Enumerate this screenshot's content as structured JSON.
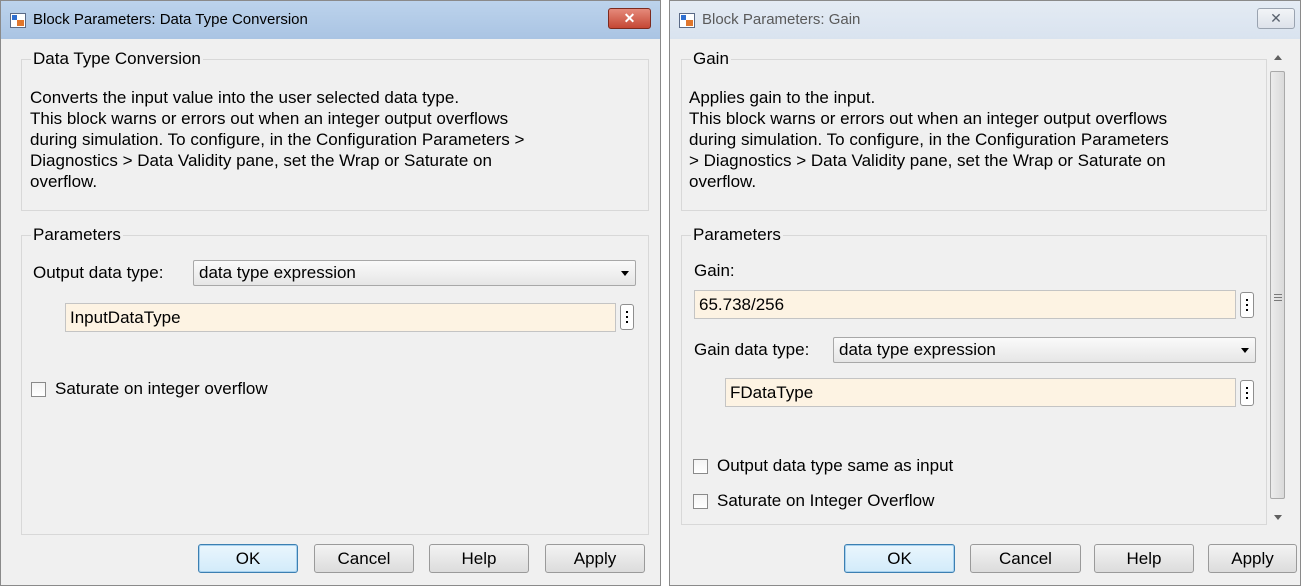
{
  "left_dialog": {
    "title": "Block Parameters: Data Type Conversion",
    "block_name": "Data Type Conversion",
    "description": [
      "Converts the input value into the user selected data type.",
      "This block warns or errors out when an integer output overflows",
      "during simulation. To configure, in the Configuration Parameters >",
      "Diagnostics > Data Validity pane, set the Wrap or Saturate on",
      "overflow."
    ],
    "parameters_label": "Parameters",
    "output_data_type_label": "Output data type:",
    "output_data_type_value": "data type expression",
    "expression_value": "InputDataType",
    "saturate_label": "Saturate on integer overflow",
    "saturate_checked": false,
    "buttons": {
      "ok": "OK",
      "cancel": "Cancel",
      "help": "Help",
      "apply": "Apply"
    }
  },
  "right_dialog": {
    "title": "Block Parameters: Gain",
    "block_name": "Gain",
    "description": [
      "Applies gain to the input.",
      "This block warns or errors out when an integer output overflows",
      "during simulation. To configure, in the Configuration Parameters",
      "> Diagnostics > Data Validity pane, set the Wrap or Saturate on",
      "overflow."
    ],
    "parameters_label": "Parameters",
    "gain_label": "Gain:",
    "gain_value": "65.738/256",
    "gain_data_type_label": "Gain data type:",
    "gain_data_type_value": "data type expression",
    "expression_value": "FDataType",
    "output_same_label": "Output data type same as input",
    "output_same_checked": false,
    "saturate_label": "Saturate on Integer Overflow",
    "saturate_checked": false,
    "buttons": {
      "ok": "OK",
      "cancel": "Cancel",
      "help": "Help",
      "apply": "Apply"
    }
  },
  "icons": {
    "app": "simulink-block-icon",
    "close": "close-icon",
    "dropdown": "chevron-down-icon",
    "more": "vertical-ellipsis-icon"
  },
  "colors": {
    "title_active": "#aac4e3",
    "title_inactive": "#d9e3ef",
    "close_active": "#c54734",
    "edit_field": "#fdf3e3",
    "dialog_bg": "#f0f0f0"
  },
  "glyphs": {
    "close": "✕"
  }
}
